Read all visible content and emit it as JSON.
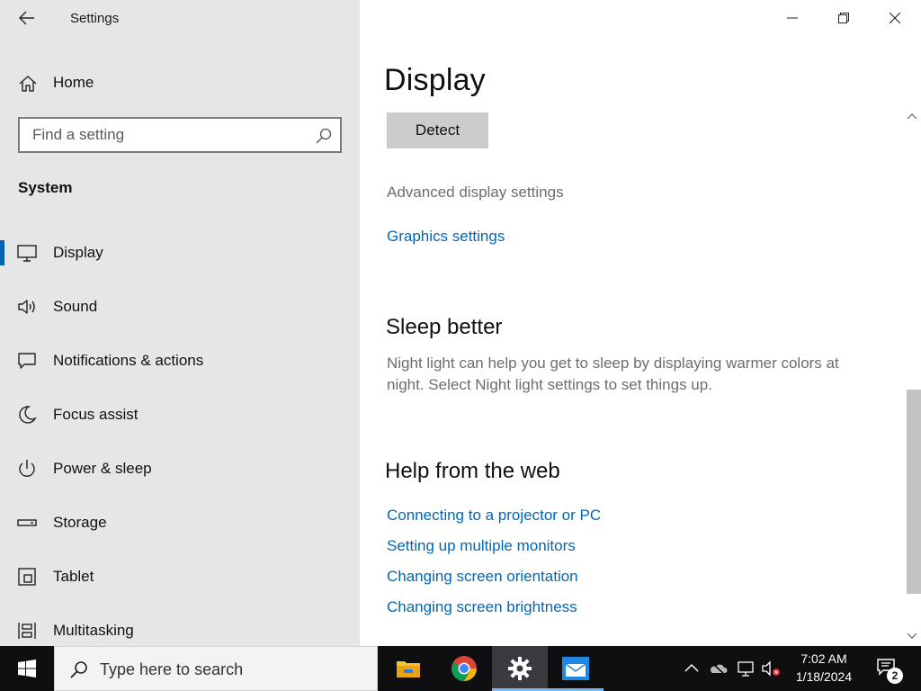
{
  "window": {
    "app_title": "Settings",
    "back_icon": "back-arrow-icon",
    "controls": [
      "minimize-icon",
      "restore-icon",
      "close-icon"
    ]
  },
  "sidebar": {
    "home_label": "Home",
    "search_placeholder": "Find a setting",
    "section_label": "System",
    "items": [
      {
        "label": "Display",
        "icon": "monitor-icon",
        "selected": true
      },
      {
        "label": "Sound",
        "icon": "speaker-icon",
        "selected": false
      },
      {
        "label": "Notifications & actions",
        "icon": "notification-icon",
        "selected": false
      },
      {
        "label": "Focus assist",
        "icon": "moon-icon",
        "selected": false
      },
      {
        "label": "Power & sleep",
        "icon": "power-icon",
        "selected": false
      },
      {
        "label": "Storage",
        "icon": "storage-icon",
        "selected": false
      },
      {
        "label": "Tablet",
        "icon": "tablet-icon",
        "selected": false
      },
      {
        "label": "Multitasking",
        "icon": "multitasking-icon",
        "selected": false
      }
    ]
  },
  "main": {
    "title": "Display",
    "detect_label": "Detect",
    "advanced_link": "Advanced display settings",
    "graphics_link": "Graphics settings",
    "sleep_heading": "Sleep better",
    "sleep_desc": "Night light can help you get to sleep by displaying warmer colors at night. Select Night light settings to set things up.",
    "help_heading": "Help from the web",
    "help_links": [
      "Connecting to a projector or PC",
      "Setting up multiple monitors",
      "Changing screen orientation",
      "Changing screen brightness"
    ]
  },
  "taskbar": {
    "search_placeholder": "Type here to search",
    "apps": [
      "file-explorer-icon",
      "chrome-icon",
      "settings-gear-icon",
      "mail-app-icon"
    ],
    "time": "7:02 AM",
    "date": "1/18/2024",
    "notification_count": "2"
  },
  "colors": {
    "accent": "#0063b1",
    "link": "#0067b8",
    "sidebar_bg": "#e6e6e6",
    "taskbar_bg": "#0f0f12"
  }
}
